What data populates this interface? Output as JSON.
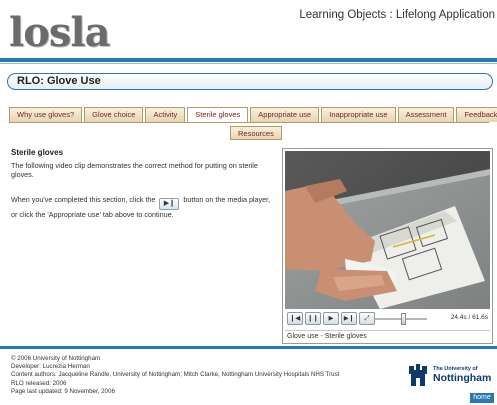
{
  "header": {
    "logo_text": "losla",
    "app_title": "Learning Objects : Lifelong Application"
  },
  "rlo": {
    "title": "RLO: Glove Use"
  },
  "tabs": [
    {
      "label": "Why use gloves?",
      "active": false
    },
    {
      "label": "Glove choice",
      "active": false
    },
    {
      "label": "Activity",
      "active": false
    },
    {
      "label": "Sterile gloves",
      "active": true
    },
    {
      "label": "Appropriate use",
      "active": false
    },
    {
      "label": "Inappropriate use",
      "active": false
    },
    {
      "label": "Assessment",
      "active": false
    },
    {
      "label": "Feedback",
      "active": false
    }
  ],
  "resources_tab": "Resources",
  "content": {
    "title": "Sterile gloves",
    "intro": "The following video clip demonstrates the correct method for putting on sterile gloves.",
    "instr_before": "When you've completed this section, click the",
    "instr_after": "button on the media player, or click the 'Appropriate use' tab above to continue.",
    "inline_button_icon": "skip-forward-icon"
  },
  "player": {
    "time": "24.4s / 61.6s",
    "caption": "Glove use - Sterile gloves",
    "volume_level": 0.55
  },
  "footer": {
    "line1": "© 2006 University of Nottingham",
    "line2": "Developer: Lucrezia Herman",
    "line3": "Content authors: Jacqueline Randle, University of Nottingham; Mitch Clarke, Nottingham University Hospitals NHS Trust",
    "line4": "RLO released: 2006",
    "line5": "Page last updated: 9 November, 2006",
    "uni_small": "The University of",
    "uni_big": "Nottingham",
    "home_label": "home"
  },
  "colors": {
    "accent_blue": "#2a78ad",
    "tab_border": "#b79a63",
    "tab_text": "#7a1f1f"
  }
}
